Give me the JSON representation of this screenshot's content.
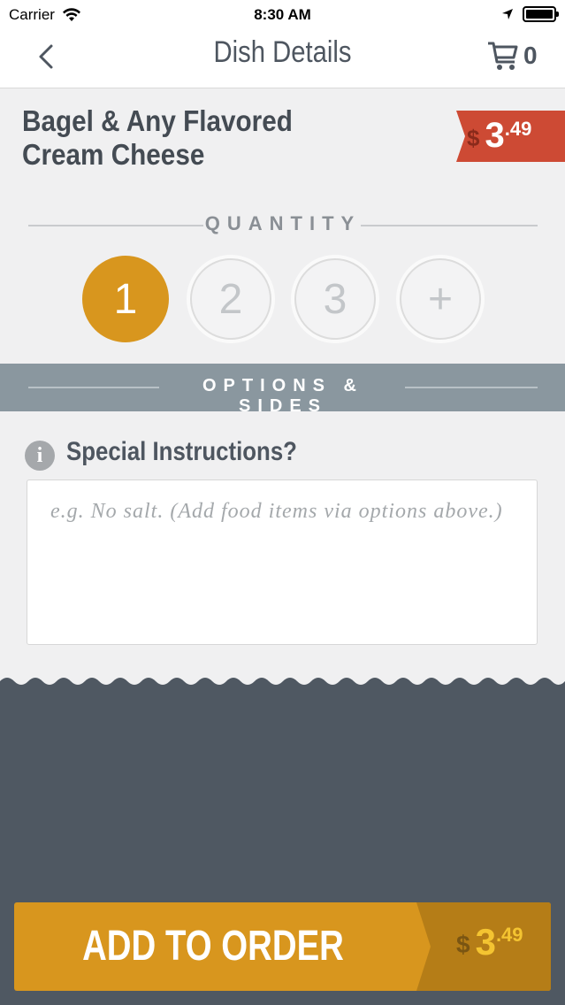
{
  "status_bar": {
    "carrier": "Carrier",
    "time": "8:30 AM"
  },
  "nav": {
    "title": "Dish Details",
    "cart_count": "0"
  },
  "dish": {
    "name_line1": "Bagel & Any Flavored",
    "name_line2": "Cream Cheese",
    "price": {
      "currency": "$",
      "dollars": "3",
      "cents": ".49"
    }
  },
  "quantity": {
    "label": "QUANTITY",
    "options": [
      "1",
      "2",
      "3",
      "+"
    ],
    "selected": "1"
  },
  "options": {
    "label": "OPTIONS & SIDES"
  },
  "special_instructions": {
    "label": "Special Instructions?",
    "placeholder": "e.g. No salt. (Add food items via options above.)"
  },
  "add_to_order": {
    "label": "ADD TO ORDER",
    "currency": "$",
    "dollars": "3",
    "cents": ".49"
  },
  "colors": {
    "accent": "#d8961e",
    "price_tag": "#cd4a34",
    "options_band": "#8a979f",
    "dark_bg": "#4f5862"
  }
}
